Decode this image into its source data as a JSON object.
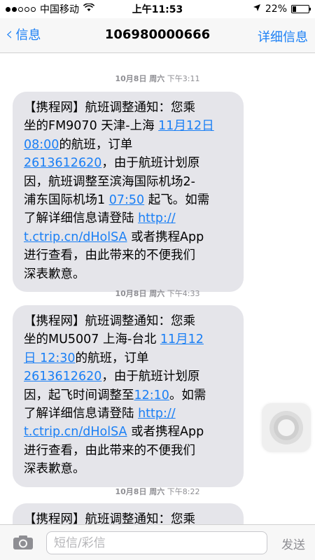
{
  "status_bar": {
    "carrier": "中国移动",
    "time": "上午11:53",
    "battery": "22%",
    "battery_level": 0.22
  },
  "nav": {
    "back_label": "信息",
    "title": "106980000666",
    "detail_label": "详细信息"
  },
  "messages": [
    {
      "timestamp_date": "10月8日 周六",
      "timestamp_time": "下午3:11",
      "lines": [
        [
          {
            "t": "【携程网】航班调整通知：您乘"
          }
        ],
        [
          {
            "t": "坐的FM9070 天津-上海 "
          },
          {
            "t": "11月12日",
            "link": true
          }
        ],
        [
          {
            "t": "08:00",
            "link": true
          },
          {
            "t": "的航班，订单"
          }
        ],
        [
          {
            "t": "2613612620",
            "link": true
          },
          {
            "t": "，由于航班计划原"
          }
        ],
        [
          {
            "t": "因，航班调整至滨海国际机场2-"
          }
        ],
        [
          {
            "t": "浦东国际机场1 "
          },
          {
            "t": "07:50",
            "link": true
          },
          {
            "t": " 起飞。如需"
          }
        ],
        [
          {
            "t": "了解详细信息请登陆 "
          },
          {
            "t": "http://",
            "link": true
          }
        ],
        [
          {
            "t": "t.ctrip.cn/dHolSA",
            "link": true
          },
          {
            "t": " 或者携程App"
          }
        ],
        [
          {
            "t": "进行查看，由此带来的不便我们"
          }
        ],
        [
          {
            "t": "深表歉意。"
          }
        ]
      ]
    },
    {
      "timestamp_date": "10月8日 周六",
      "timestamp_time": "下午4:33",
      "lines": [
        [
          {
            "t": "【携程网】航班调整通知：您乘"
          }
        ],
        [
          {
            "t": "坐的MU5007 上海-台北 "
          },
          {
            "t": "11月12",
            "link": true
          }
        ],
        [
          {
            "t": "日 12:30",
            "link": true
          },
          {
            "t": "的航班，订单"
          }
        ],
        [
          {
            "t": "2613612620",
            "link": true
          },
          {
            "t": "，由于航班计划原"
          }
        ],
        [
          {
            "t": "因，起飞时间调整至"
          },
          {
            "t": "12:10",
            "link": true
          },
          {
            "t": "。如需"
          }
        ],
        [
          {
            "t": "了解详细信息请登陆 "
          },
          {
            "t": "http://",
            "link": true
          }
        ],
        [
          {
            "t": "t.ctrip.cn/dHolSA",
            "link": true
          },
          {
            "t": " 或者携程App"
          }
        ],
        [
          {
            "t": "进行查看，由此带来的不便我们"
          }
        ],
        [
          {
            "t": "深表歉意。"
          }
        ]
      ]
    },
    {
      "timestamp_date": "10月8日 周六",
      "timestamp_time": "下午8:22",
      "lines": [
        [
          {
            "t": "【携程网】航班调整通知：您乘"
          }
        ]
      ]
    }
  ],
  "input": {
    "placeholder": "短信/彩信",
    "send_label": "发送"
  },
  "colors": {
    "accent": "#1a7ff5",
    "bubble": "#e5e5ea",
    "timestamp": "#8e8e93"
  }
}
